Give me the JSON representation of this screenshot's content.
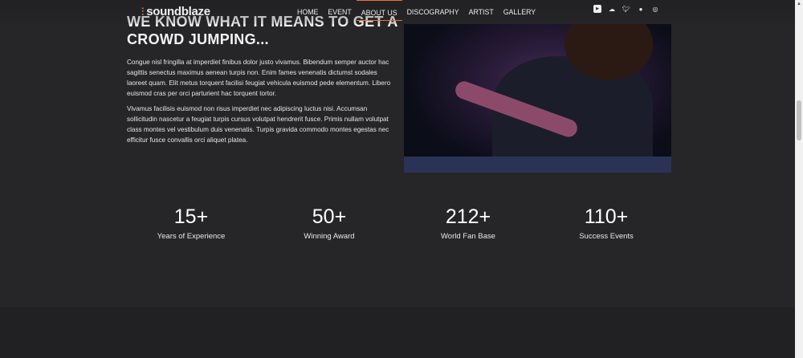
{
  "brand": "soundblaze",
  "nav": [
    "HOME",
    "EVENT",
    "ABOUT US",
    "DISCOGRAPHY",
    "ARTIST",
    "GALLERY"
  ],
  "social": [
    "youtube-icon",
    "soundcloud-icon",
    "twitter-icon",
    "spotify-icon",
    "instagram-icon"
  ],
  "about": {
    "heading": "WE KNOW WHAT IT MEANS TO GET A CROWD JUMPING...",
    "p1": "Congue nisl fringilla at imperdiet finibus dolor justo vivamus. Bibendum semper auctor hac sagittis senectus maximus aenean turpis non. Enim fames venenatis dictumst sodales laoreet quam. Elit metus torquent facilisi feugiat vehicula euismod pede elementum. Libero euismod cras per orci parturient hac torquent tortor.",
    "p2": "Vivamus facilisis euismod non risus imperdiet nec adipiscing luctus nisi. Accumsan sollicitudin nascetur a feugiat turpis cursus volutpat hendrerit fusce. Primis nullam volutpat class montes vel vestibulum duis venenatis. Turpis gravida commodo montes egestas nec efficitur fusce convallis orci aliquet platea."
  },
  "stats": [
    {
      "num": "15+",
      "label": "Years of Experience"
    },
    {
      "num": "50+",
      "label": "Winning Award"
    },
    {
      "num": "212+",
      "label": "World Fan Base"
    },
    {
      "num": "110+",
      "label": "Success Events"
    }
  ],
  "colors": {
    "accent": "#e8743a",
    "bg": "#262628"
  }
}
